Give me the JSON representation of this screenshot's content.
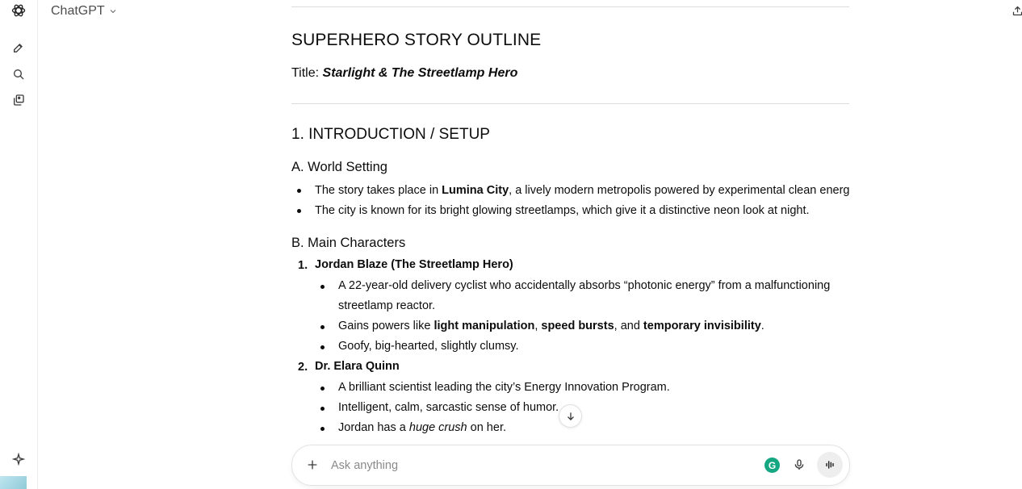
{
  "header": {
    "model_name": "ChatGPT"
  },
  "composer": {
    "placeholder": "Ask anything"
  },
  "outline": {
    "heading": "SUPERHERO STORY OUTLINE",
    "title_label": "Title: ",
    "title_value": "Starlight & The Streetlamp Hero",
    "section1": "1. INTRODUCTION / SETUP",
    "subA": "A. World Setting",
    "a1_pre": "The story takes place in ",
    "a1_bold": "Lumina City",
    "a1_post": ", a lively modern metropolis powered by experimental clean energy.",
    "a2": "The city is known for its bright glowing streetlamps, which give it a distinctive neon look at night.",
    "subB": "B. Main Characters",
    "c1_num": "1.",
    "c1_name": "Jordan Blaze (The Streetlamp Hero)",
    "c1_b1_line1": "A 22-year-old delivery cyclist who accidentally absorbs “photonic energy” from a malfunctioning",
    "c1_b1_line2": "streetlamp reactor.",
    "c1_b2_pre": "Gains powers like ",
    "c1_b2_bold1": "light manipulation",
    "c1_b2_sep": ", ",
    "c1_b2_bold2": "speed bursts",
    "c1_b2_and": ", and ",
    "c1_b2_bold3": "temporary invisibility",
    "c1_b2_end": ".",
    "c1_b3": "Goofy, big-hearted, slightly clumsy.",
    "c2_num": "2.",
    "c2_name": "Dr. Elara Quinn",
    "c2_b1": "A brilliant scientist leading the city’s Energy Innovation Program.",
    "c2_b2": "Intelligent, calm, sarcastic sense of humor.",
    "c2_b3_pre": "Jordan has a ",
    "c2_b3_em": "huge crush",
    "c2_b3_post": " on her."
  },
  "icons": {
    "logo": "openai-logo-icon",
    "new_chat": "new-chat-icon",
    "search": "search-icon",
    "library": "library-icon",
    "sparkle": "sparkle-icon",
    "share": "share-icon",
    "scroll_down": "arrow-down-icon",
    "plus": "plus-icon",
    "grammarly": "grammarly-icon",
    "mic": "microphone-icon",
    "voice": "voice-mode-icon"
  },
  "colors": {
    "grammarly": "#15a682",
    "text": "#0d0d0d",
    "placeholder": "#8a8a8a"
  }
}
